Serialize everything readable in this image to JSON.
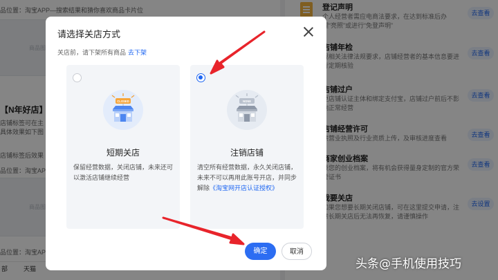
{
  "background": {
    "left": {
      "row_top": "品位置：淘宝APP—搜索结果和猜你喜欢商品卡片位",
      "image_placeholder_1": "商品图片",
      "heading": "【N年好店】",
      "line_1": "店铺标签可在主",
      "line_2": "具体效果如下图",
      "line_3": "店铺标签后效果",
      "line_4": "品位置：淘宝APP—",
      "image_placeholder_2": "商品图片",
      "line_5": "品位置：淘宝APP",
      "bottom_tab_1": "部",
      "bottom_tab_2": "天猫"
    },
    "right": {
      "items": [
        {
          "title": "登记声明",
          "desc": "个人经营者需应电商法要求，在达到标准后办理“亮照”或进行“免登声明”",
          "button": "去查看"
        },
        {
          "title": "店铺年检",
          "desc": "规相关法律法规要求，店铺经营者的基本信息要进行定期核验",
          "button": "去查看"
        },
        {
          "title": "店铺过户",
          "desc": "更店铺认证主体和绑定支付宝，店铺过户前后不影响正常经营",
          "button": "去查看"
        },
        {
          "title": "店铺经营许可",
          "desc": "供营业执照及行业资质上传，及审核进度查看",
          "button": "去查看"
        },
        {
          "title": "商家创业档案",
          "desc": "录您的创业档案，将有机会获得量身定制的官方荣誉证书",
          "button": "去查看"
        },
        {
          "title": "我要关店",
          "desc": "如果您想要长期关闭店铺，可在这里提交申请，注意长期关店后无法再恢复，请谨慎操作",
          "button": "去设置"
        }
      ]
    }
  },
  "modal": {
    "title": "请选择关店方式",
    "notice": "关店前，请下架所有商品",
    "notice_link": "去下架",
    "options": [
      {
        "title": "短期关店",
        "badge": "CLOSED",
        "desc": "保留经营数据，关闭店铺，未来还可以激活店铺继续经营",
        "selected": false
      },
      {
        "title": "注销店铺",
        "badge": "NONE",
        "desc_prefix": "清空所有经营数据，永久关闭店铺，未来不可以再用此账号开店，并同步解除",
        "desc_link": "《淘宝网开店认证授权》",
        "selected": true
      }
    ],
    "confirm_label": "确定",
    "cancel_label": "取消"
  },
  "watermark": "头条@手机使用技巧",
  "colors": {
    "primary": "#2c6df2",
    "link": "#1f67f2",
    "annotation_arrow": "#e8242b",
    "overlay": "rgba(0,0,0,0.48)"
  }
}
